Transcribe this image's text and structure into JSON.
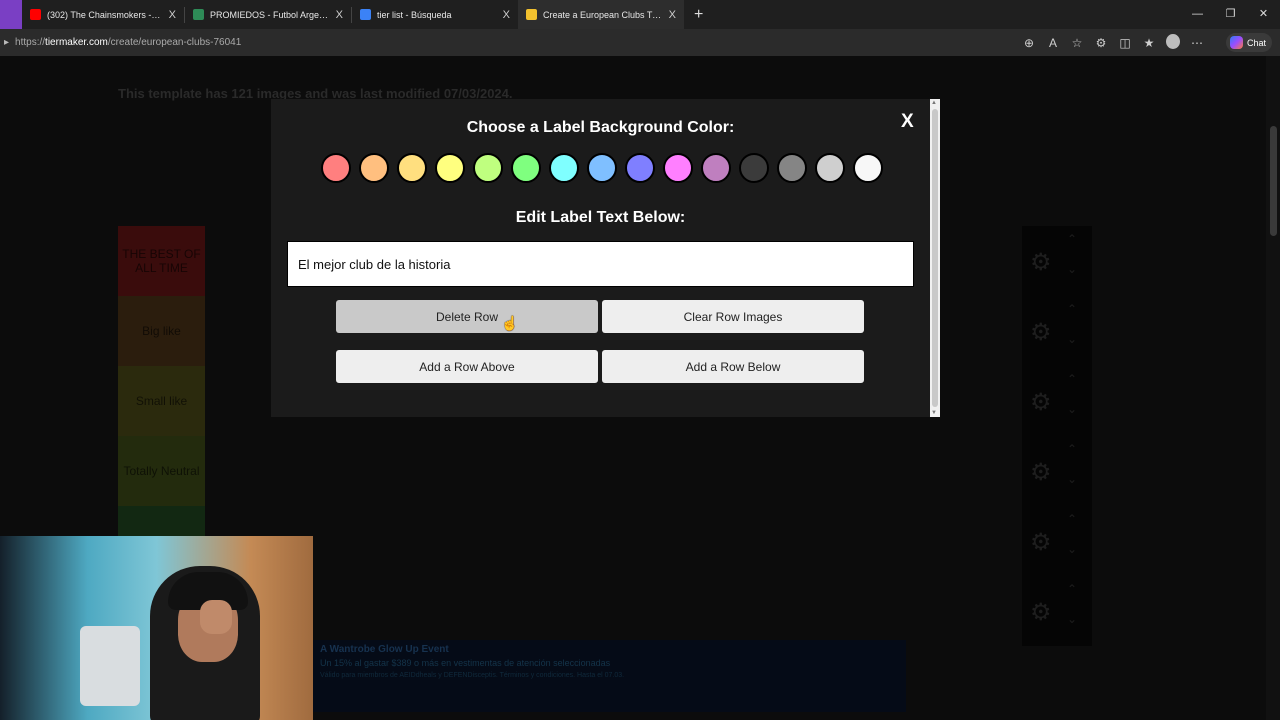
{
  "browser": {
    "tabs": [
      {
        "title": "(302) The Chainsmokers - Closer (",
        "favicon_color": "#ff0000"
      },
      {
        "title": "PROMIEDOS - Futbol Argentino - ",
        "favicon_color": "#2e8b57"
      },
      {
        "title": "tier list - Búsqueda",
        "favicon_color": "#3b82f6"
      },
      {
        "title": "Create a European Clubs Tier List",
        "favicon_color": "#f2c12e"
      }
    ],
    "close_glyph": "X",
    "new_tab_glyph": "+",
    "window_controls": [
      "—",
      "❐",
      "✕"
    ],
    "url_prefix": "https://",
    "url_domain": "tiermaker.com",
    "url_path": "/create/european-clubs-76041",
    "chat_label": "Chat"
  },
  "page": {
    "template_info": "This template has 121 images and was last modified 07/03/2024.",
    "tiers": [
      {
        "label": "THE BEST OF ALL TIME",
        "color": "#3a0c0c"
      },
      {
        "label": "Big like",
        "color": "#2b1d0d"
      },
      {
        "label": "Small like",
        "color": "#2b2a0d"
      },
      {
        "label": "Totally Neutral",
        "color": "#232b0d"
      },
      {
        "label": "",
        "color": "#122812"
      }
    ],
    "row_controls_count": 6,
    "ad": {
      "title": "A Wantrobe Glow Up Event",
      "line": "Un 15% al gastar $389 o más en vestimentas de atención seleccionadas",
      "small": "Válido para miembros de AEIDdheals y DEFENDisceptis. Términos y condiciones. Hasta el 07.03."
    }
  },
  "modal": {
    "color_heading": "Choose a Label Background Color:",
    "text_heading": "Edit Label Text Below:",
    "close_label": "X",
    "label_text": "El mejor club de la historia",
    "colors": [
      "#ff7f7f",
      "#ffbf7f",
      "#ffdf7f",
      "#ffff7f",
      "#bfff7f",
      "#7fff7f",
      "#7fffff",
      "#7fbfff",
      "#7f7fff",
      "#ff7fff",
      "#bf7fbf",
      "#3b3b3b",
      "#858585",
      "#cfcfcf",
      "#f7f7f7"
    ],
    "buttons": {
      "delete_row": "Delete Row",
      "clear_row_images": "Clear Row Images",
      "add_row_above": "Add a Row Above",
      "add_row_below": "Add a Row Below"
    }
  }
}
